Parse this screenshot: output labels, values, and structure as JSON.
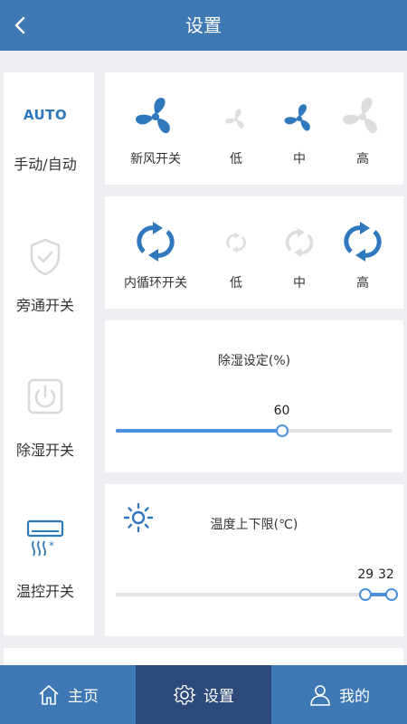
{
  "header": {
    "title": "设置"
  },
  "modes": [
    {
      "label": "手动/自动",
      "badge": "AUTO"
    },
    {
      "label": "旁通开关"
    },
    {
      "label": "除湿开关"
    },
    {
      "label": "温控开关"
    }
  ],
  "fresh_air": {
    "options": [
      {
        "label": "新风开关"
      },
      {
        "label": "低"
      },
      {
        "label": "中"
      },
      {
        "label": "高"
      }
    ]
  },
  "recirculation": {
    "options": [
      {
        "label": "内循环开关"
      },
      {
        "label": "低"
      },
      {
        "label": "中"
      },
      {
        "label": "高"
      }
    ]
  },
  "dehumidify": {
    "title": "除湿设定(%)",
    "value": 60,
    "value_text": "60",
    "min": 0,
    "max": 100
  },
  "temperature": {
    "title": "温度上下限(℃)",
    "low": 29,
    "high": 32,
    "low_text": "29",
    "high_text": "32",
    "min": 0,
    "max": 32
  },
  "nav": {
    "home": "主页",
    "settings": "设置",
    "mine": "我的"
  },
  "colors": {
    "primary": "#3e78b5",
    "accent": "#4a90df",
    "icon_blue": "#2f78bd",
    "nav_active": "#2e4a7a",
    "icon_gray": "#dddddd"
  }
}
